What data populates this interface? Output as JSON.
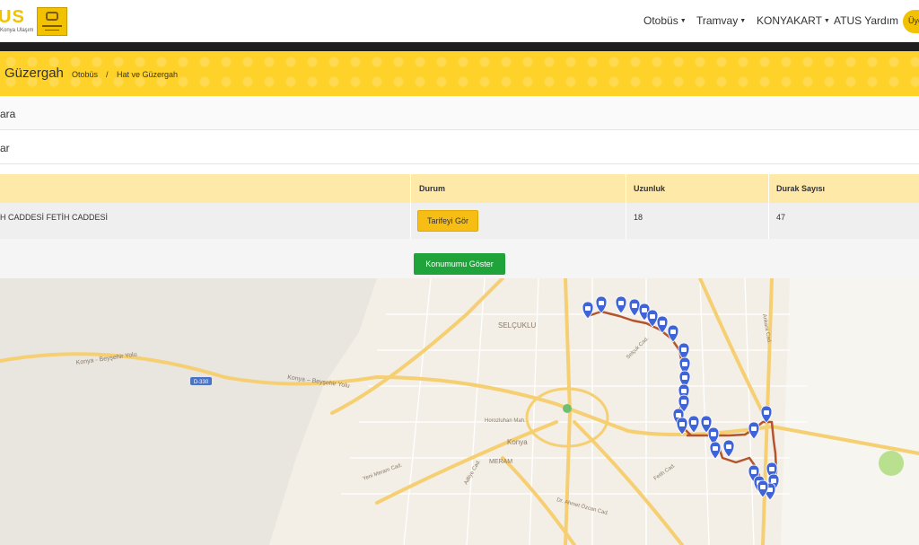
{
  "header": {
    "logo_text": "US",
    "logo_sub": "Konya Ulaşım",
    "nav": [
      {
        "label": "Otobüs",
        "dropdown": true
      },
      {
        "label": "Tramvay",
        "dropdown": true
      },
      {
        "label": "KONYAKART",
        "dropdown": true
      },
      {
        "label": "ATUS Yardım",
        "dropdown": false
      }
    ],
    "user_label": "Üye"
  },
  "title_band": {
    "title": "Güzergah",
    "breadcrumb": [
      "Otobüs",
      "Hat ve Güzergah"
    ],
    "separator": "/"
  },
  "rows": {
    "row_a": "ara",
    "row_b": "ar"
  },
  "table": {
    "headers": [
      "",
      "Durum",
      "Uzunluk",
      "Durak Sayısı"
    ],
    "row": {
      "route": "H CADDESİ FETİH CADDESİ",
      "status_button": "Tarifeyi Gör",
      "length": "18",
      "stop_count": "47"
    }
  },
  "actions": {
    "show_location": "Konumumu Göster"
  },
  "map": {
    "labels": {
      "selcuklu": "SELÇUKLU",
      "konya": "Konya",
      "meram": "MERAM",
      "road_beysehir": "Konya - Beyşehir Yolu",
      "road_konya_beysehir": "Konya – Beyşehir Yolu",
      "highway": "D-330",
      "yeni_meram": "Yeni Meram Cad.",
      "fetih": "Fetih Cad.",
      "ahmet_ozcan": "Dr. Ahmet Özcan Cad.",
      "adliye": "Adliye Cad.",
      "selcuk": "Selçuk Cad.",
      "horozluhan": "Horozluhan Mah.",
      "ankara": "Ankara Cad."
    },
    "colors": {
      "route": "#b5532c",
      "marker": "#3f63d8",
      "road": "#f6cf72",
      "park": "#b9e08f"
    }
  }
}
